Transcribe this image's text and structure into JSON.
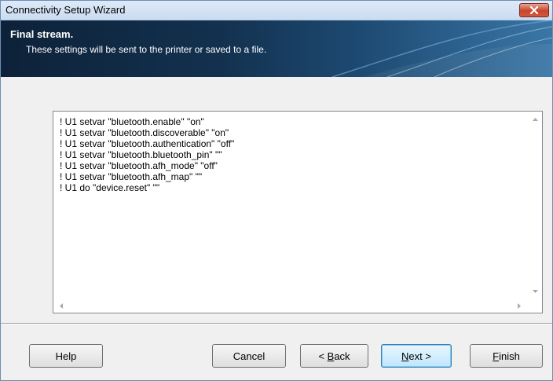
{
  "window": {
    "title": "Connectivity Setup Wizard",
    "close_icon": "close-icon"
  },
  "banner": {
    "title": "Final stream.",
    "subtitle": "These settings will be sent to the printer or saved to a file."
  },
  "stream": {
    "lines": [
      "! U1 setvar \"bluetooth.enable\" \"on\"",
      "! U1 setvar \"bluetooth.discoverable\" \"on\"",
      "! U1 setvar \"bluetooth.authentication\" \"off\"",
      "! U1 setvar \"bluetooth.bluetooth_pin\" \"\"",
      "! U1 setvar \"bluetooth.afh_mode\" \"off\"",
      "! U1 setvar \"bluetooth.afh_map\" \"\"",
      "! U1 do \"device.reset\" \"\""
    ]
  },
  "buttons": {
    "help": "Help",
    "cancel": "Cancel",
    "back_prefix": "< ",
    "back_mnemonic": "B",
    "back_rest": "ack",
    "next_mnemonic": "N",
    "next_rest": "ext >",
    "finish_mnemonic": "F",
    "finish_rest": "inish"
  }
}
